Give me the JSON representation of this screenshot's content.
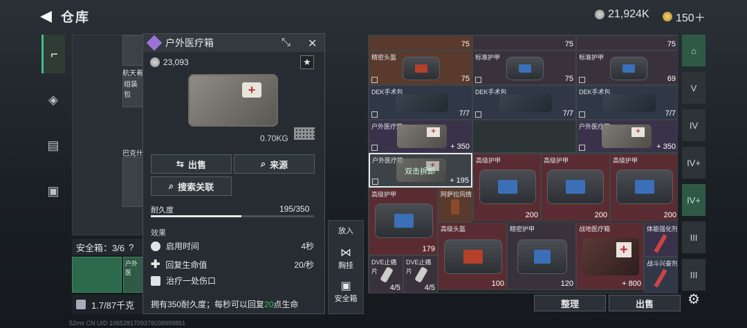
{
  "header": {
    "title": "仓库",
    "back": "◀",
    "coins": "21,924K",
    "premium": "150＋"
  },
  "nav_left": [
    "gun-icon",
    "armor-icon",
    "vest-icon",
    "case-icon"
  ],
  "stash": {
    "labels": [
      "航天着",
      "组装包",
      "巴克什"
    ],
    "safebox_label": "安全箱：3/6",
    "safebox_q": "?",
    "slot_label": "户外医",
    "weight": "1.7/87千克"
  },
  "panel": {
    "name": "户外医疗箱",
    "price": "23,093",
    "weight": "0.70KG",
    "buttons": {
      "sell": "出售",
      "source": "来源",
      "search": "搜索关联"
    },
    "durability_label": "耐久度",
    "durability_value": "195/350",
    "durability_fraction": 0.557,
    "effects_label": "效果",
    "effects": [
      {
        "label": "启用时间",
        "value": "4秒"
      },
      {
        "label": "回复生命值",
        "value": "20/秒"
      },
      {
        "label": "治疗一处伤口",
        "value": ""
      }
    ],
    "desc_pre": "拥有350耐久度；每秒可以回复",
    "desc_num": "20",
    "desc_post": "点生命"
  },
  "side": {
    "put": "放入",
    "chest": "胸挂",
    "safe": "安全箱"
  },
  "grid": {
    "r0": [
      "75",
      "75",
      "75"
    ],
    "r1": [
      {
        "n": "精密头盔",
        "b": "75"
      },
      {
        "n": "标准护甲",
        "b": "75"
      },
      {
        "n": "标准护甲",
        "b": "69"
      }
    ],
    "r2": [
      {
        "n": "DEK手术包",
        "b": "7/7"
      },
      {
        "n": "DEK手术包",
        "b": "7/7"
      },
      {
        "n": "DEK手术包",
        "b": "7/7"
      }
    ],
    "r3": [
      {
        "n": "户外医疗箱",
        "b": "350"
      },
      {
        "n": "户外医疗箱",
        "b": "350"
      }
    ],
    "r4": {
      "sel_n": "户外医疗箱",
      "sel_b": "195",
      "sel_overlay": "双击拆卸",
      "armor_n": "高级护甲"
    },
    "r5": {
      "armor_n": "高级护甲",
      "armor_b": "179",
      "drink": "阿萨拉风情",
      "b200": "200"
    },
    "r6": [
      {
        "n": "高级头盔",
        "b": "100"
      },
      {
        "n": "精密护甲",
        "b": "120"
      },
      {
        "n": "战地医疗箱",
        "b": "800"
      },
      {
        "n": "体能强化剂",
        "b": ""
      }
    ],
    "pills": [
      {
        "n": "DVE止痛片",
        "b": "4/5"
      },
      {
        "n": "DVE止痛片",
        "b": "4/5"
      }
    ],
    "boost": "战斗兴奋剂"
  },
  "bottom": {
    "sort": "整理",
    "sell": "出售"
  },
  "footer": "52ms   CN UID 1065281709376038999861"
}
